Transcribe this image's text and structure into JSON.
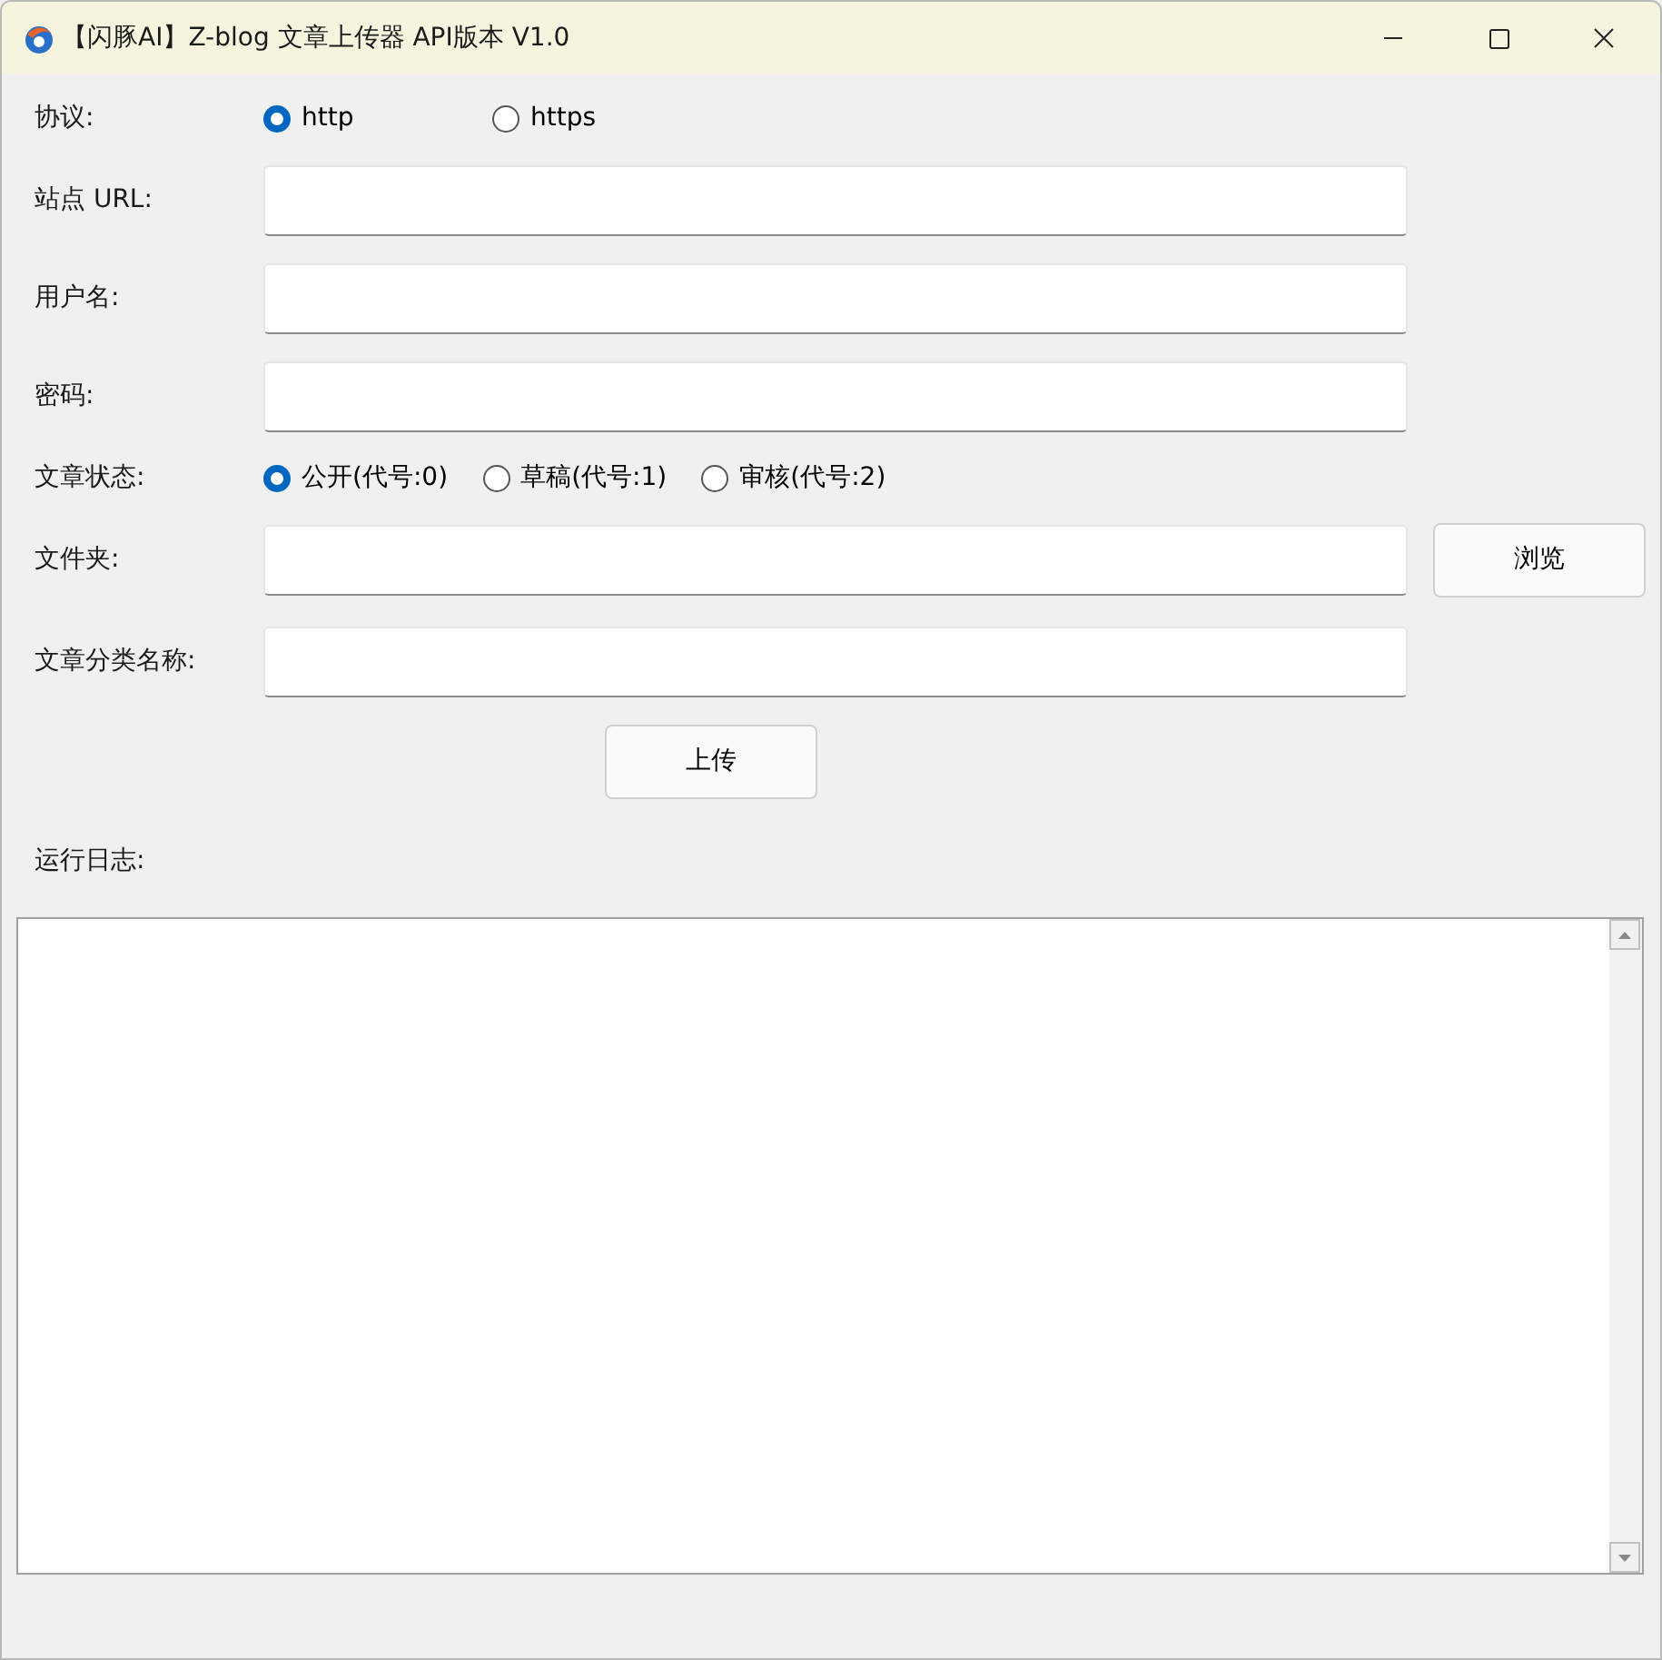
{
  "window": {
    "title": "【闪豚AI】Z-blog 文章上传器 API版本 V1.0"
  },
  "rows": [
    {
      "kind": "radio",
      "label": "协议:",
      "options": [
        {
          "label": "http",
          "selected": true
        },
        {
          "label": "https",
          "selected": false
        }
      ]
    },
    {
      "kind": "field",
      "label": "站点 URL:"
    },
    {
      "kind": "field",
      "label": "用户名:"
    },
    {
      "kind": "field",
      "label": "密码:"
    },
    {
      "kind": "radio",
      "label": "文章状态:",
      "options": [
        {
          "label": "公开(代号:0)",
          "selected": true
        },
        {
          "label": "草稿(代号:1)",
          "selected": false
        },
        {
          "label": "审核(代号:2)",
          "selected": false
        }
      ]
    },
    {
      "kind": "field",
      "label": "文件夹:",
      "button": "浏览"
    },
    {
      "kind": "field",
      "label": "文章分类名称:"
    }
  ],
  "upload_button": "上传",
  "log": {
    "label": "运行日志:"
  }
}
